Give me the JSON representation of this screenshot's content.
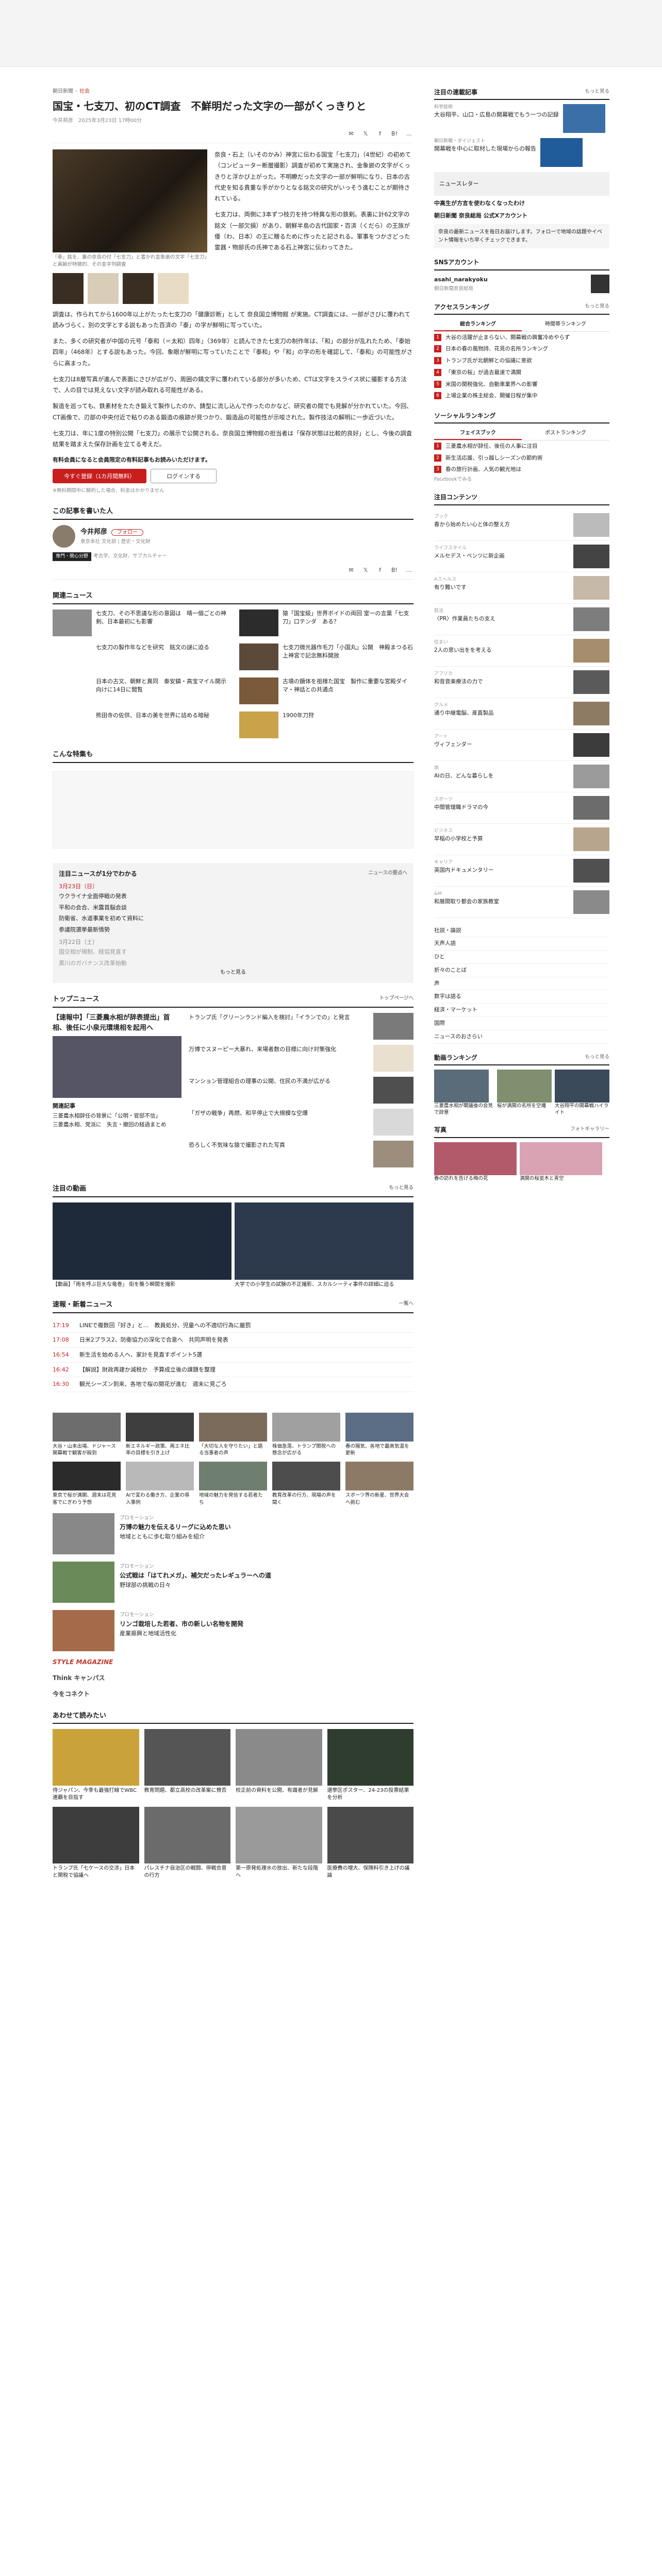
{
  "breadcrumb": [
    "朝日新聞",
    "社会"
  ],
  "article": {
    "title": "国宝・七支刀、初のCT調査　不鮮明だった文字の一部がくっきりと",
    "byline": "今井邦彦　2025年3月23日 17時00分",
    "photo_caption": "「泰」銘を、裏の奈良の付「七支刀」と書かれ金象嵌の文字「七支刀」と真鍮が特徴的、その金字列調査",
    "paragraphs": [
      "奈良・石上（いそのかみ）神宮に伝わる国宝「七支刀」（4世紀）の初めて（コンピューター断層撮影）調査が初めて実施され、金象嵌の文字がくっきりと浮かび上がった。不明瞭だった文字の一部が鮮明になり、日本の古代史を知る貴重な手がかりとなる銘文の研究がいっそう進むことが期待されている。",
      "七支刀は、両側に3本ずつ枝刃を持つ特異な形の鉄剣。表裏に計62文字の銘文（一部欠損）があり、朝鮮半島の古代国家・百済（くだら）の王族が倭（わ、日本）の王に贈るために作ったと記される。軍事をつかさどった霊器・物部氏の氏神である石上神宮に伝わってきた。",
      "調査は、作られてから1600年以上がたった七支刀の「健康診断」として 奈良国立博物館 が実施。CT調査には、一部がさびに覆われて読みづらく、別の文字とする説もあった百済の「泰」の字が鮮明に写っていた。",
      "また、多くの研究者が中国の元号「泰和（＝太和）四年」（369年）と読んできた七支刀の制作年は、「和」の部分が乱れたため、「泰始四年」（468年）とする説もあった。今回、象眼が鮮明に写っていたことで「泰和」や「和」の字の形を確認して、「泰和」の可能性がさらに高まった。",
      "七支刀は8層写真が進んで表面にさびが広がり、周囲の錆文字に覆われている部分が多いため、CTは文字をスライス状に撮影する方法で、人の目では見えない文字が読み取れる可能性がある。",
      "製造を巡っても、鉄素材をたたき鍛えて製作したのか、鋳型に流し込んで作ったのかなど、研究者の間でも見解が分かれていた。今回、CT画像で、刃部の中央付近で粘りのある鍛造の痕跡が見つかり、鍛造品の可能性が示唆された。製作技法の解明に一歩近づいた。",
      "七支刀は、年に1度の特別公開「七支刀」の展示で公開される。奈良国立博物館の担当者は「保存状態は比較的良好」とし、今後の調査結果を踏まえた保存計画を立てる考えだ。"
    ],
    "paywall_note": "有料会員になると会員限定の有料記事もお読みいただけます。",
    "subscribe_button": "今すぐ登録（1カ月間無料）",
    "login_button": "ログインする",
    "fine_print": "※無料期間中に解約した場合、料金はかかりません"
  },
  "author": {
    "section_title": "この記事を書いた人",
    "name": "今井邦彦",
    "desc": "東京本社 文化部 | 歴史・文化財",
    "follow": "フォロー",
    "tag": "専門・関心分野",
    "fields": "考古学、文化財、サブカルチャー"
  },
  "related": {
    "title": "関連ニュース",
    "items": [
      "七支刀、その不思議な形の意図は　晴一個ごとの神剣、日本最初にも影響",
      "猿「国宝級」世界ボイドの両回 室一の言葉「七支刀」口テンダ　ある？",
      "七支刀の製作年などを研究　銘文の謎に迫る",
      "七支刀微光器作毛刀「小国丸」公開　神殿まつる石上神宮で記念無料開放",
      "日本の古文、朝鮮と異同　泰安鎮・高宝マイル開示向けに14日に閲覧",
      "古墳の鏡体を祖様た国宝　製作に重要な宮殿ダイマ・神話との共通点",
      "熊田寺の佐供、日本の美を世界に詰める暗秘",
      "1900年刀狩"
    ]
  },
  "konna": {
    "title": "こんな特集も"
  },
  "trend": {
    "title": "注目ニュースが1分でわかる",
    "more": "ニュースの要点へ",
    "date1": "3月23日（日）",
    "items": [
      "ウクライナ全面停戦の発表",
      "平和の会合、米露首脳会談",
      "防衛省、水道事業を初めて資料に",
      "参議院選挙最新情勢"
    ],
    "date2": "3月22日（土）",
    "items2": [
      "国交相が規制、経協見直す",
      "黒川のガバナンス改革始動"
    ],
    "more2": "もっと見る"
  },
  "topnews": {
    "title": "トップニュース",
    "more": "トップページへ",
    "headline": "【速報中】「三菱農水相が辞表提出」首相、後任に小泉元環境相を起用へ",
    "items": [
      "トランプ氏「グリーンランド編入を検討」「イランでの」と発言",
      "万博でスヌーピー大暴れ、来場者数の目標に向け対策強化",
      "マンション管理組合の理事の公開、住民の不満が広がる",
      "「ガザの戦争」再燃、和平停止で大規模な空爆",
      "恐ろしく不気味な猿で撮影された写真"
    ],
    "related_title": "関連記事",
    "related": [
      "三菱農水相辞任の背景に「公明・官邸不信」",
      "三菱農水相、党派に　失言・撤回の経過まとめ"
    ]
  },
  "videos": {
    "title": "注目の動画",
    "more": "もっと見る",
    "items": [
      "【動画】「雨を呼ぶ巨大な竜巻」 街を襲う瞬間を撮影",
      "大学での小学生の試験の不正撮影、スカルシーティ事件の詳細に迫る"
    ]
  },
  "breaking": {
    "title": "速報・新着ニュース",
    "more": "一覧へ",
    "items": [
      {
        "time": "17:19",
        "text": "LINEで複数回「好き」と…　教員処分、児童への不適切行為に厳罰"
      },
      {
        "time": "17:08",
        "text": "日米2プラス2、防衛協力の深化で合意へ　共同声明を発表"
      },
      {
        "time": "16:54",
        "text": "新生活を始める人へ、家計を見直すポイント5選"
      },
      {
        "time": "16:42",
        "text": "【解説】財政再建か減税か　予算成立後の課題を整理"
      },
      {
        "time": "16:30",
        "text": "観光シーズン到来、各地で桜の開花が進む　週末に見ごろ"
      }
    ]
  },
  "tiles": [
    "大谷・山本出場、ドジャース開幕戦で観客が殺到",
    "新エネルギー政策、再エネ比率の目標を引き上げ",
    "「大切な人を守りたい」と語る当事者の声",
    "株価急落、トランプ関税への懸念が広がる",
    "春の陽気、各地で最高気温を更新",
    "東京で桜が満開、週末は花見客でにぎわう予想",
    "AIで変わる働き方、企業の導入事例",
    "地域の魅力を発信する若者たち",
    "教育改革の行方、現場の声を聞く",
    "スポーツ界の新星、世界大会へ挑む"
  ],
  "promos": [
    {
      "kicker": "プロモーション",
      "title": "万博の魅力を伝えるリーグに込めた思い",
      "text": "地域とともに歩む取り組みを紹介"
    },
    {
      "kicker": "プロモーション",
      "title": "公式戦は「はてれメガ」、補欠だったレギュラーへの道",
      "text": "野球部の挑戦の日々"
    },
    {
      "kicker": "プロモーション",
      "title": "リンゴ栽培した若者、市の新しい名物を開発",
      "text": "産業振興と地域活性化"
    }
  ],
  "brands": [
    "STYLE MAGAZINE",
    "Think キャンパス",
    "今をコネクト"
  ],
  "also": {
    "title": "あわせて読みたい",
    "items": [
      "侍ジャパン、今季も最強打線でWBC連覇を目指す",
      "教育問題、都立高校の改革案に賛否",
      "校正前の資料を公開、有識者が見解",
      "選挙区ポスター、24-23の投票結果を分析",
      "トランプ氏「七ケースの交渉」日本と関税で協議へ",
      "パレスチナ自治区の戦闘、停戦合意の行方",
      "第一原発処理水の放出、新たな段階へ",
      "医療費の増大、保険料引き上げの議論"
    ]
  },
  "sidebar": {
    "chumoku": {
      "title": "注目の連載記事",
      "more": "もっと見る",
      "items": [
        {
          "tag": "科学技術",
          "text": "大谷翔平、山口・広島の開幕戦でもう一つの記録"
        },
        {
          "tag": "朝日新聞・ダイジェスト",
          "text": "開幕戦を中心に取材した現場からの報告"
        }
      ],
      "banner": "ニュースレター",
      "links": [
        "中高生が方言を使わなくなったわけ",
        "朝日新聞 奈良総局 公式Xアカウント"
      ],
      "box": "奈良の最新ニュースを毎日お届けします。フォローで地域の話題やイベント情報をいち早くチェックできます。"
    },
    "sns": {
      "title": "SNSアカウント",
      "name": "asahi_narakyoku",
      "sub": "朝日新聞奈良総局"
    },
    "access": {
      "title": "アクセスランキング",
      "more": "もっと見る",
      "tabs": [
        "総合ランキング",
        "時間帯ランキング"
      ],
      "items": [
        "大谷の活躍が止まらない、開幕戦の興奮冷めやらず",
        "日本の春の風物詩、花見の名所ランキング",
        "トランプ氏が北朝鮮との協議に意欲",
        "「東京の桜」が過去最速で満開",
        "米国の関税強化、自動車業界への影響",
        "上場企業の株主総会、開催日程が集中"
      ]
    },
    "social": {
      "title": "ソーシャルランキング",
      "tabs": [
        "フェイスブック",
        "ポストランキング"
      ],
      "items": [
        "三菱農水相が辞任、後任の人事に注目",
        "新生活応援、引っ越しシーズンの節約術",
        "春の旅行計画、人気の観光地は"
      ],
      "more": "Facebookでみる"
    },
    "contents": {
      "title": "注目コンテンツ",
      "items": [
        {
          "k": "ブック",
          "t": "春から始めたい心と体の整え方"
        },
        {
          "k": "ライフスタイル",
          "t": "メルセデス・ベンツに新企画"
        },
        {
          "k": "A.T.ヘルス",
          "t": "有り難いです"
        },
        {
          "k": "就活",
          "t": "〈PR〉作業員たちの支え"
        },
        {
          "k": "住まい",
          "t": "2人の思い出をを考える"
        },
        {
          "k": "アフリカ",
          "t": "和音音楽療法の力で"
        },
        {
          "k": "グルメ",
          "t": "通り中継電脳、産直製品"
        },
        {
          "k": "アート",
          "t": "ヴィフェンダー"
        },
        {
          "k": "旅",
          "t": "AIの日、どんな暮らしを"
        },
        {
          "k": "スポーツ",
          "t": "中間管理職ドラマの今"
        },
        {
          "k": "ビジネス",
          "t": "早稲の小学校と予算"
        },
        {
          "k": "キャリア",
          "t": "英国内ドキュメンタリー"
        },
        {
          "k": "&M",
          "t": "和展間取り都会の家族教室"
        }
      ]
    },
    "list": [
      "社説・論説",
      "天声人語",
      "ひと",
      "折々のことば",
      "声",
      "数字は語る",
      "経済・マーケット",
      "国際",
      "ニュースのおさらい"
    ],
    "douga": {
      "title": "動画ランキング",
      "more": "もっと見る",
      "items": [
        "三菱農水相が閣議後の会見で辞意",
        "桜が満開の名所を空撮",
        "大谷翔平の開幕戦ハイライト"
      ]
    },
    "shashin": {
      "title": "写真",
      "more": "フォトギャラリー",
      "items": [
        "春の訪れを告げる梅の花",
        "満開の桜並木と青空"
      ]
    }
  }
}
